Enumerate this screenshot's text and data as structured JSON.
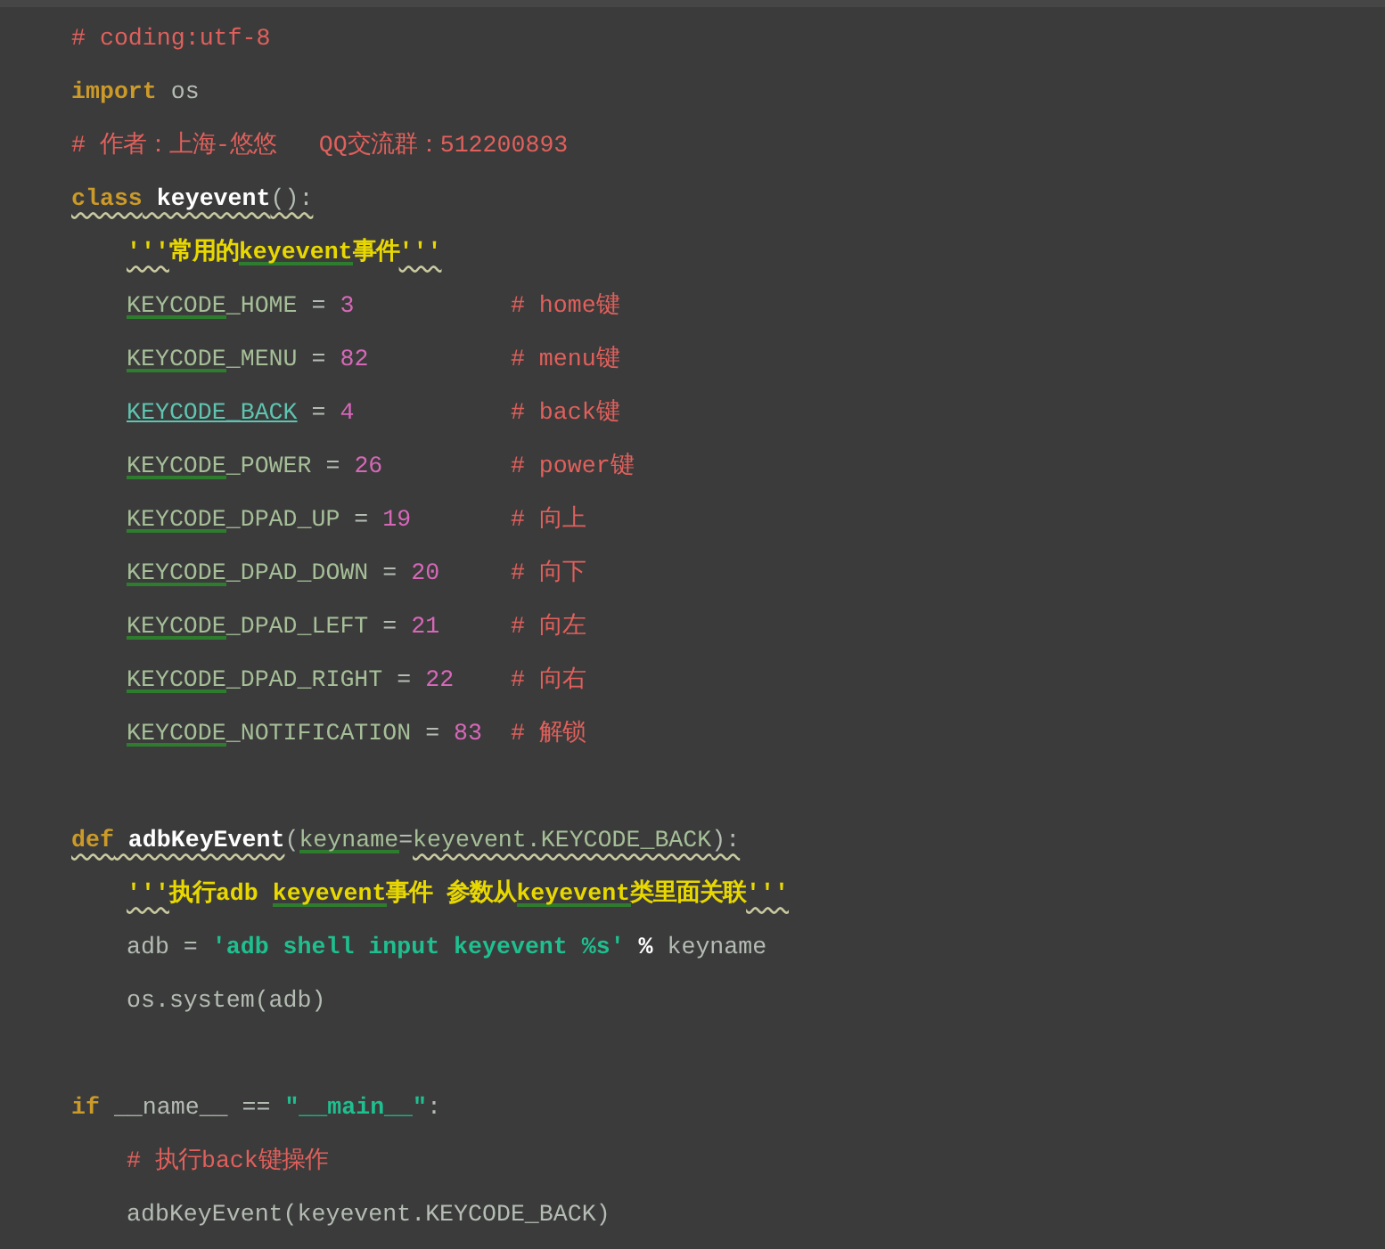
{
  "editor": {
    "lines": [
      {
        "tokens": [
          {
            "kind": "comment",
            "text": "# coding:utf-8",
            "warning": false,
            "typo": false
          }
        ]
      },
      {
        "tokens": [
          {
            "kind": "keyword",
            "text": "import",
            "warning": false,
            "typo": false
          },
          {
            "kind": "plain",
            "text": " os",
            "warning": false,
            "typo": false
          }
        ]
      },
      {
        "tokens": [
          {
            "kind": "comment",
            "text": "# 作者：上海-悠悠   QQ交流群：512200893",
            "warning": false,
            "typo": false
          }
        ]
      },
      {
        "tokens": [
          {
            "kind": "keyword",
            "text": "class",
            "warning": true,
            "typo": false
          },
          {
            "kind": "defname",
            "text": " keyevent",
            "warning": true,
            "typo": false
          },
          {
            "kind": "plain",
            "text": "():",
            "warning": true,
            "typo": false
          }
        ],
        "children": [
          {
            "tokens": [
              {
                "kind": "docstring",
                "text": "'''",
                "warning": true,
                "typo": false
              },
              {
                "kind": "docstring",
                "text": "常用的",
                "warning": false,
                "typo": false
              },
              {
                "kind": "docstring",
                "text": "keyevent",
                "warning": false,
                "typo": true
              },
              {
                "kind": "docstring",
                "text": "事件",
                "warning": false,
                "typo": false
              },
              {
                "kind": "docstring",
                "text": "'''",
                "warning": true,
                "typo": false
              }
            ]
          },
          {
            "tokens": [
              {
                "kind": "name",
                "text": "KEYCODE",
                "warning": false,
                "typo": true
              },
              {
                "kind": "name",
                "text": "_HOME",
                "warning": false,
                "typo": false
              },
              {
                "kind": "plain",
                "text": " = ",
                "warning": false,
                "typo": false
              },
              {
                "kind": "number",
                "text": "3",
                "warning": false,
                "typo": false
              },
              {
                "kind": "trailing_comment",
                "text": "# home键",
                "warning": false,
                "typo": false
              }
            ]
          },
          {
            "tokens": [
              {
                "kind": "name",
                "text": "KEYCODE",
                "warning": false,
                "typo": true
              },
              {
                "kind": "name",
                "text": "_MENU",
                "warning": false,
                "typo": false
              },
              {
                "kind": "plain",
                "text": " = ",
                "warning": false,
                "typo": false
              },
              {
                "kind": "number",
                "text": "82",
                "warning": false,
                "typo": false
              },
              {
                "kind": "trailing_comment",
                "text": "# menu键",
                "warning": false,
                "typo": false
              }
            ]
          },
          {
            "tokens": [
              {
                "kind": "reference",
                "text": "KEYCODE_BACK",
                "warning": false,
                "typo": false
              },
              {
                "kind": "plain",
                "text": " = ",
                "warning": false,
                "typo": false
              },
              {
                "kind": "number",
                "text": "4",
                "warning": false,
                "typo": false
              },
              {
                "kind": "trailing_comment",
                "text": "# back键",
                "warning": false,
                "typo": false
              }
            ]
          },
          {
            "tokens": [
              {
                "kind": "name",
                "text": "KEYCODE",
                "warning": false,
                "typo": true
              },
              {
                "kind": "name",
                "text": "_POWER",
                "warning": false,
                "typo": false
              },
              {
                "kind": "plain",
                "text": " = ",
                "warning": false,
                "typo": false
              },
              {
                "kind": "number",
                "text": "26",
                "warning": false,
                "typo": false
              },
              {
                "kind": "trailing_comment",
                "text": "# power键",
                "warning": false,
                "typo": false
              }
            ]
          },
          {
            "tokens": [
              {
                "kind": "name",
                "text": "KEYCODE",
                "warning": false,
                "typo": true
              },
              {
                "kind": "name",
                "text": "_DPAD_UP",
                "warning": false,
                "typo": false
              },
              {
                "kind": "plain",
                "text": " = ",
                "warning": false,
                "typo": false
              },
              {
                "kind": "number",
                "text": "19",
                "warning": false,
                "typo": false
              },
              {
                "kind": "trailing_comment",
                "text": "# 向上",
                "warning": false,
                "typo": false
              }
            ]
          },
          {
            "tokens": [
              {
                "kind": "name",
                "text": "KEYCODE",
                "warning": false,
                "typo": true
              },
              {
                "kind": "name",
                "text": "_DPAD_DOWN",
                "warning": false,
                "typo": false
              },
              {
                "kind": "plain",
                "text": " = ",
                "warning": false,
                "typo": false
              },
              {
                "kind": "number",
                "text": "20",
                "warning": false,
                "typo": false
              },
              {
                "kind": "trailing_comment",
                "text": "# 向下",
                "warning": false,
                "typo": false
              }
            ]
          },
          {
            "tokens": [
              {
                "kind": "name",
                "text": "KEYCODE",
                "warning": false,
                "typo": true
              },
              {
                "kind": "name",
                "text": "_DPAD_LEFT",
                "warning": false,
                "typo": false
              },
              {
                "kind": "plain",
                "text": " = ",
                "warning": false,
                "typo": false
              },
              {
                "kind": "number",
                "text": "21",
                "warning": false,
                "typo": false
              },
              {
                "kind": "trailing_comment",
                "text": "# 向左",
                "warning": false,
                "typo": false
              }
            ]
          },
          {
            "tokens": [
              {
                "kind": "name",
                "text": "KEYCODE",
                "warning": false,
                "typo": true
              },
              {
                "kind": "name",
                "text": "_DPAD_RIGHT",
                "warning": false,
                "typo": false
              },
              {
                "kind": "plain",
                "text": " = ",
                "warning": false,
                "typo": false
              },
              {
                "kind": "number",
                "text": "22",
                "warning": false,
                "typo": false
              },
              {
                "kind": "trailing_comment",
                "text": "# 向右",
                "warning": false,
                "typo": false
              }
            ]
          },
          {
            "tokens": [
              {
                "kind": "name",
                "text": "KEYCODE",
                "warning": false,
                "typo": true
              },
              {
                "kind": "name",
                "text": "_NOTIFICATION",
                "warning": false,
                "typo": false
              },
              {
                "kind": "plain",
                "text": " = ",
                "warning": false,
                "typo": false
              },
              {
                "kind": "number",
                "text": "83",
                "warning": false,
                "typo": false
              },
              {
                "kind": "trailing_comment",
                "text": "# 解锁",
                "warning": false,
                "typo": false
              }
            ]
          }
        ]
      },
      {
        "blank": true
      },
      {
        "tokens": [
          {
            "kind": "keyword",
            "text": "def",
            "warning": true,
            "typo": false
          },
          {
            "kind": "defname",
            "text": " adbKeyEvent",
            "warning": true,
            "typo": false
          },
          {
            "kind": "plain",
            "text": "(",
            "warning": false,
            "typo": false
          },
          {
            "kind": "name",
            "text": "keyname",
            "warning": false,
            "typo": true
          },
          {
            "kind": "plain",
            "text": "=",
            "warning": false,
            "typo": false
          },
          {
            "kind": "name",
            "text": "keyevent.KEYCODE_BACK",
            "warning": true,
            "typo": false
          },
          {
            "kind": "plain",
            "text": "):",
            "warning": true,
            "typo": false
          }
        ],
        "children": [
          {
            "tokens": [
              {
                "kind": "docstring",
                "text": "'''",
                "warning": true,
                "typo": false
              },
              {
                "kind": "docstring",
                "text": "执行adb ",
                "warning": false,
                "typo": false
              },
              {
                "kind": "docstring",
                "text": "keyevent",
                "warning": false,
                "typo": true
              },
              {
                "kind": "docstring",
                "text": "事件 参数从",
                "warning": false,
                "typo": false
              },
              {
                "kind": "docstring",
                "text": "keyevent",
                "warning": false,
                "typo": true
              },
              {
                "kind": "docstring",
                "text": "类里面关联",
                "warning": false,
                "typo": false
              },
              {
                "kind": "docstring",
                "text": "'''",
                "warning": true,
                "typo": false
              }
            ]
          },
          {
            "tokens": [
              {
                "kind": "plain",
                "text": "adb = ",
                "warning": false,
                "typo": false
              },
              {
                "kind": "string",
                "text": "'adb shell input keyevent %s'",
                "warning": false,
                "typo": false
              },
              {
                "kind": "operator",
                "text": " %",
                "warning": false,
                "typo": false
              },
              {
                "kind": "plain",
                "text": " keyname",
                "warning": false,
                "typo": false
              }
            ]
          },
          {
            "tokens": [
              {
                "kind": "plain",
                "text": "os.system(adb)",
                "warning": false,
                "typo": false
              }
            ]
          }
        ]
      },
      {
        "blank": true
      },
      {
        "tokens": [
          {
            "kind": "keyword",
            "text": "if",
            "warning": false,
            "typo": false
          },
          {
            "kind": "plain",
            "text": " __name__ == ",
            "warning": false,
            "typo": false
          },
          {
            "kind": "string",
            "text": "\"__main__\"",
            "warning": false,
            "typo": false
          },
          {
            "kind": "plain",
            "text": ":",
            "warning": false,
            "typo": false
          }
        ],
        "children": [
          {
            "tokens": [
              {
                "kind": "comment",
                "text": "# 执行back键操作",
                "warning": false,
                "typo": false
              }
            ]
          },
          {
            "tokens": [
              {
                "kind": "plain",
                "text": "adbKeyEvent(keyevent.KEYCODE_BACK)",
                "warning": false,
                "typo": false
              }
            ]
          }
        ]
      }
    ]
  }
}
